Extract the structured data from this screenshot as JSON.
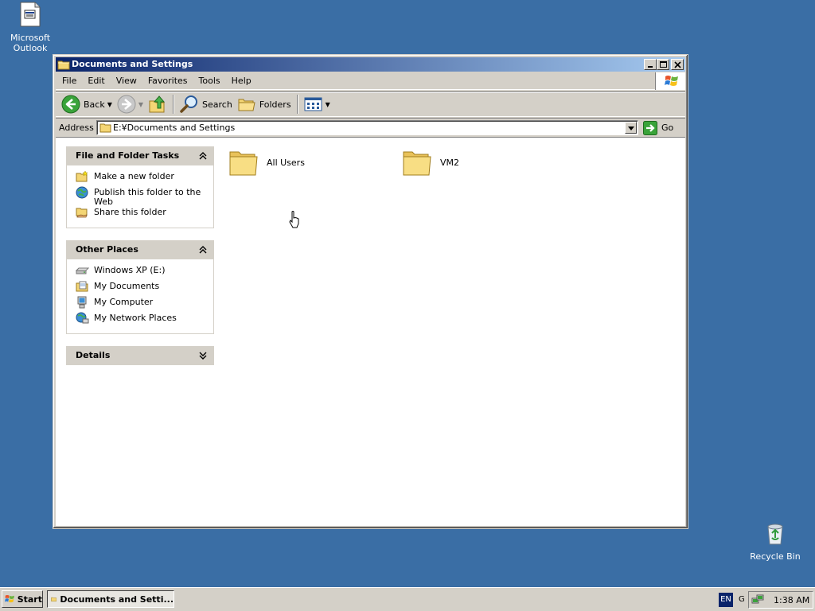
{
  "desktop": {
    "icons": [
      {
        "label_line1": "Microsoft",
        "label_line2": "Outlook",
        "icon": "outlook-shortcut-icon"
      },
      {
        "label": "Recycle Bin",
        "icon": "recycle-bin-icon"
      }
    ]
  },
  "window": {
    "title": "Documents and Settings",
    "menu": [
      "File",
      "Edit",
      "View",
      "Favorites",
      "Tools",
      "Help"
    ],
    "toolbar": {
      "back_label": "Back",
      "search_label": "Search",
      "folders_label": "Folders"
    },
    "address": {
      "label": "Address",
      "value": "E:¥Documents and Settings",
      "go_label": "Go"
    },
    "task_pane": {
      "file_tasks": {
        "title": "File and Folder Tasks",
        "items": [
          {
            "label": "Make a new folder",
            "icon": "new-folder-icon"
          },
          {
            "label_line1": "Publish this folder to the",
            "label_line2": "Web",
            "icon": "publish-web-icon"
          },
          {
            "label": "Share this folder",
            "icon": "share-folder-icon"
          }
        ]
      },
      "other_places": {
        "title": "Other Places",
        "items": [
          {
            "label": "Windows XP (E:)",
            "icon": "drive-icon"
          },
          {
            "label": "My Documents",
            "icon": "my-documents-icon"
          },
          {
            "label": "My Computer",
            "icon": "my-computer-icon"
          },
          {
            "label": "My Network Places",
            "icon": "network-places-icon"
          }
        ]
      },
      "details": {
        "title": "Details"
      }
    },
    "files": [
      {
        "name": "All Users",
        "icon": "folder-icon"
      },
      {
        "name": "VM2",
        "icon": "folder-icon"
      }
    ]
  },
  "taskbar": {
    "start_label": "Start",
    "task_button_label": "Documents and Setti...",
    "language": "EN",
    "tray_extra": "G",
    "clock": "1:38 AM"
  },
  "colors": {
    "desktop": "#3a6ea5",
    "titlebar_start": "#0a246a",
    "titlebar_end": "#a6caf0",
    "face": "#d4d0c8"
  }
}
